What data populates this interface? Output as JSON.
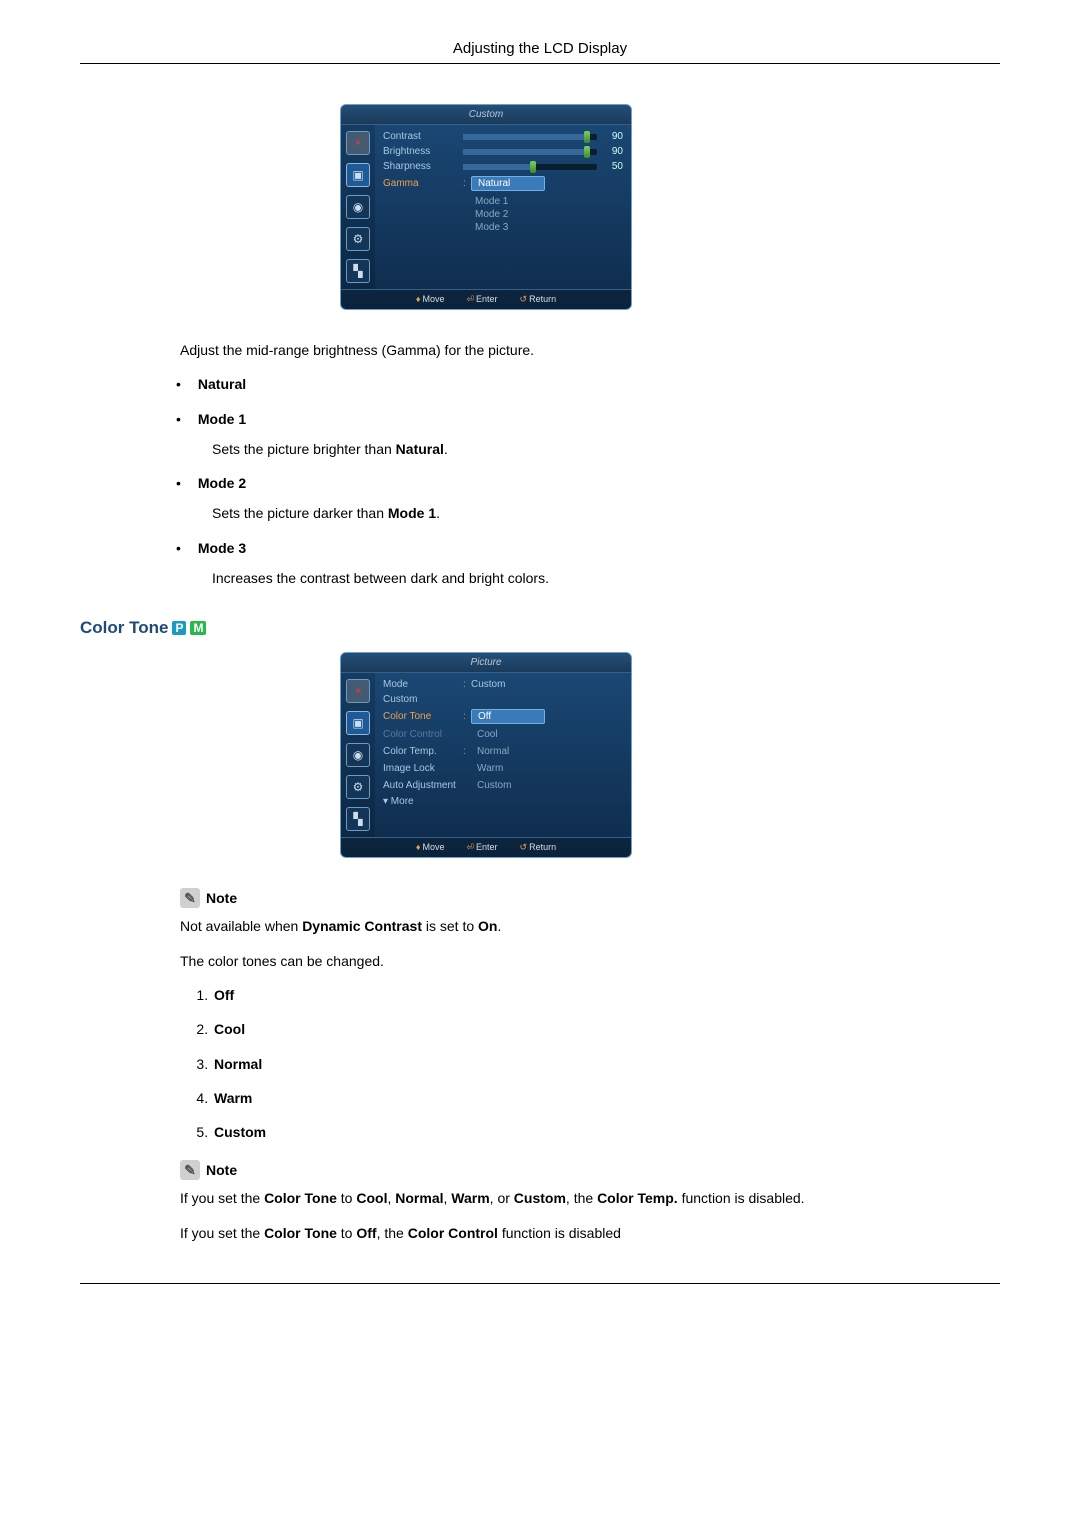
{
  "header": {
    "title": "Adjusting the LCD Display"
  },
  "osd1": {
    "title": "Custom",
    "rows": [
      {
        "label": "Contrast",
        "value": "90",
        "pct": 90
      },
      {
        "label": "Brightness",
        "value": "90",
        "pct": 90
      },
      {
        "label": "Sharpness",
        "value": "50",
        "pct": 50
      }
    ],
    "gamma_label": "Gamma",
    "gamma_options": [
      "Natural",
      "Mode 1",
      "Mode 2",
      "Mode 3"
    ],
    "footer": {
      "move": "Move",
      "enter": "Enter",
      "return": "Return"
    }
  },
  "gamma": {
    "intro": "Adjust the mid-range brightness (Gamma) for the picture.",
    "items": [
      {
        "name": "Natural",
        "desc": ""
      },
      {
        "name": "Mode 1",
        "desc_pre": "Sets the picture brighter than ",
        "desc_bold": "Natural",
        "desc_post": "."
      },
      {
        "name": "Mode 2",
        "desc_pre": "Sets the picture darker than ",
        "desc_bold": "Mode 1",
        "desc_post": "."
      },
      {
        "name": "Mode 3",
        "desc_pre": "Increases the contrast between dark and bright colors.",
        "desc_bold": "",
        "desc_post": ""
      }
    ]
  },
  "section2": {
    "title": "Color Tone",
    "badges": [
      "P",
      "M"
    ]
  },
  "osd2": {
    "title": "Picture",
    "rows": [
      {
        "label": "Mode",
        "value": "Custom"
      },
      {
        "label": "Custom",
        "value": ""
      },
      {
        "label": "Color Tone",
        "value": "Off",
        "selected": true,
        "active": true
      },
      {
        "label": "Color Control",
        "value": "Cool",
        "dim": true
      },
      {
        "label": "Color Temp.",
        "value": "Normal"
      },
      {
        "label": "Image Lock",
        "value": "Warm"
      },
      {
        "label": "Auto Adjustment",
        "value": "Custom"
      },
      {
        "label": "▾ More",
        "value": ""
      }
    ],
    "footer": {
      "move": "Move",
      "enter": "Enter",
      "return": "Return"
    }
  },
  "note1": {
    "label": "Note",
    "text_pre": "Not available when ",
    "text_b1": "Dynamic Contrast",
    "text_mid": " is set to ",
    "text_b2": "On",
    "text_post": "."
  },
  "ct_intro": "The color tones can be changed.",
  "ct_list": [
    "Off",
    "Cool",
    "Normal",
    "Warm",
    "Custom"
  ],
  "note2": {
    "label": "Note",
    "line1": {
      "pre": "If you set the ",
      "b1": "Color Tone",
      "mid1": " to ",
      "b2": "Cool",
      "c1": ", ",
      "b3": "Normal",
      "c2": ", ",
      "b4": "Warm",
      "c3": ", or ",
      "b5": "Custom",
      "mid2": ", the ",
      "b6": "Color Temp.",
      "post": " function is disabled."
    },
    "line2": {
      "pre": "If you set the ",
      "b1": "Color Tone",
      "mid1": " to ",
      "b2": "Off",
      "mid2": ", the ",
      "b3": "Color Control",
      "post": " function is disabled"
    }
  }
}
